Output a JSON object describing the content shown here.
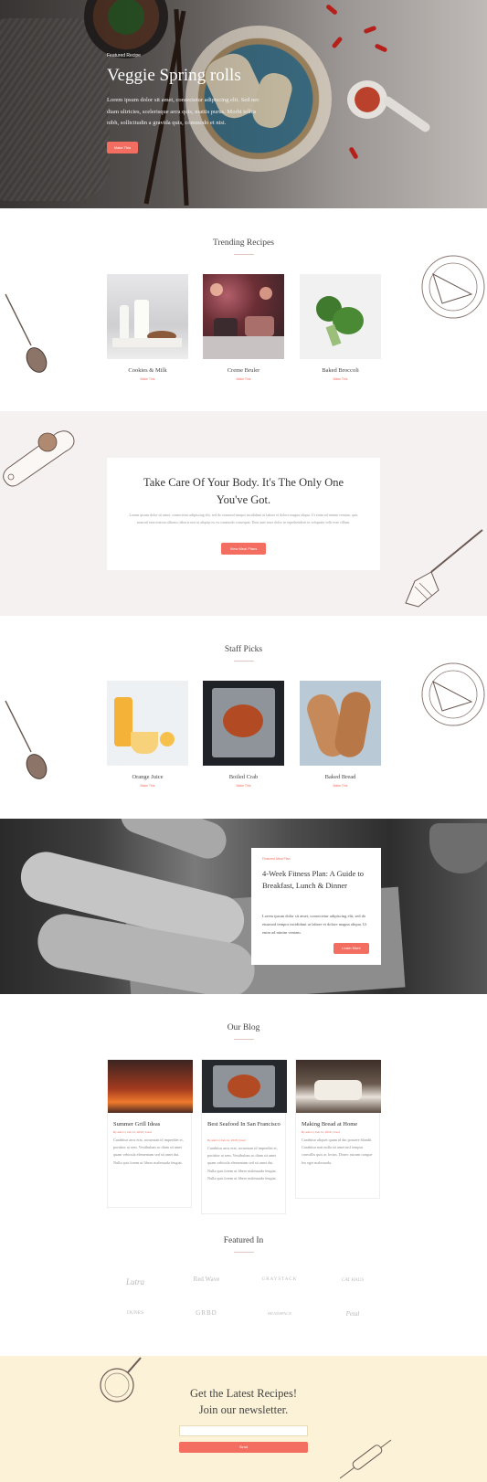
{
  "hero": {
    "featured_label": "Featured Recipe",
    "title": "Veggie Spring rolls",
    "text": "Lorem ipsum dolor sit amet, consectetur adipiscing elit. Sed nec diam ultricies, scelerisque arcu quis, mattis purus. Morbi tellus nibh, sollicitudin a gravida quis, commodo et nisi.",
    "button": "Make This"
  },
  "trending": {
    "title": "Trending Recipes",
    "items": [
      {
        "name": "Cookies & Milk",
        "link": "Make This"
      },
      {
        "name": "Creme Bruler",
        "link": "Make This"
      },
      {
        "name": "Baked Broccoli",
        "link": "Make This"
      }
    ]
  },
  "motto": {
    "title": "Take Care Of Your Body. It's The Only One You've Got.",
    "text": "Lorem ipsum dolor sit amet, consectetur adipiscing elit, sed do eiusmod tempor incididunt ut labore et dolore magna aliqua. Ut enim ad minim veniam, quis nostrud exercitation ullamco laboris nisi ut aliquip ex ea commodo consequat. Duis aute irure dolor in reprehenderit in voluptate velit esse cillum.",
    "button": "View Meal Plans"
  },
  "staff": {
    "title": "Staff Picks",
    "items": [
      {
        "name": "Orange Juice",
        "link": "Make This"
      },
      {
        "name": "Boiled Crab",
        "link": "Make This"
      },
      {
        "name": "Baked Bread",
        "link": "Make This"
      }
    ]
  },
  "fitness": {
    "tag": "Featured Meal Plan",
    "title": "4-Week Fitness Plan: A Guide to Breakfast, Lunch & Dinner",
    "text": "Lorem ipsum dolor sit amet, consectetur adipiscing elit, sed do eiusmod tempor incididunt ut labore et dolore magna aliqua. Ut enim ad minim veniam.",
    "button": "Learn More"
  },
  "blog": {
    "title": "Our Blog",
    "posts": [
      {
        "title": "Summer Grill Ideas",
        "meta": "By admin | Feb 11, 2018 | Food",
        "text": "Curabitur arcu erat, accumsan id imperdiet et, porttitor at sem. Vestibulum ac diam sit amet quam vehicula elementum sed sit amet dui. Nulla quis lorem ut libero malesuada feugiat."
      },
      {
        "title": "Best Seafood In San Francisco",
        "meta": "By admin | Feb 11, 2018 | Food",
        "text": "Curabitur arcu erat, accumsan id imperdiet et, porttitor at sem. Vestibulum ac diam sit amet quam vehicula elementum sed sit amet dui. Nulla quis lorem ut libero malesuada feugiat. Nulla quis lorem ut libero malesuada feugiat."
      },
      {
        "title": "Making Bread at Home",
        "meta": "By admin | Feb 11, 2018 | Food",
        "text": "Curabitur aliquet quam id dui posuere blandit. Curabitur non nulla sit amet nisl tempus convallis quis ac lectus. Donec rutrum congue leo eget malesuada."
      }
    ]
  },
  "featured": {
    "title": "Featured In",
    "logos": [
      "Lutra",
      "Red Wave",
      "GRAYSTACK",
      "CAT HAUS",
      "DUNES",
      "GRBD",
      "HEADSPACE",
      "Petal"
    ]
  },
  "newsletter": {
    "title_line1": "Get the Latest Recipes!",
    "title_line2": "Join our newsletter.",
    "input_placeholder": "",
    "button": "Send"
  },
  "colors": {
    "accent": "#f36e60",
    "motto_band": "#f6f1f1",
    "newsletter_band": "#fbf2d8"
  }
}
